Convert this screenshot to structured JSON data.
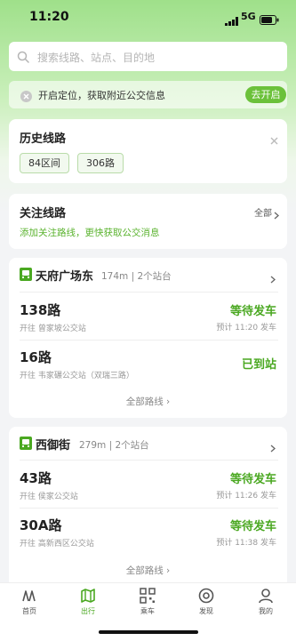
{
  "status_bar": {
    "time": "11:20",
    "network": "5G"
  },
  "search": {
    "placeholder": "搜索线路、站点、目的地"
  },
  "location_banner": {
    "text": "开启定位，获取附近公交信息",
    "button_label": "去开启"
  },
  "history": {
    "title": "历史线路",
    "items": [
      "84区间",
      "306路"
    ]
  },
  "follow": {
    "title": "关注线路",
    "all_label": "全部",
    "hint": "添加关注路线，更快获取公交消息"
  },
  "stops": [
    {
      "name": "天府广场东",
      "meta": "174m | 2个站台",
      "routes": [
        {
          "name": "138路",
          "origin": "开往 曾家坡公交站",
          "status": "等待发车",
          "eta": "预计 11:20 发车"
        },
        {
          "name": "16路",
          "origin": "开往 韦家碾公交站（双瑞三路）",
          "status": "已到站",
          "eta": ""
        }
      ],
      "all_routes_label": "全部路线"
    },
    {
      "name": "西御街",
      "meta": "279m | 2个站台",
      "routes": [
        {
          "name": "43路",
          "origin": "开往 侯家公交站",
          "status": "等待发车",
          "eta": "预计 11:26 发车"
        },
        {
          "name": "30A路",
          "origin": "开往 高新西区公交站",
          "status": "等待发车",
          "eta": "预计 11:38 发车"
        }
      ],
      "all_routes_label": "全部路线"
    }
  ],
  "tab_bar": {
    "items": [
      {
        "label": "首页",
        "icon": "home-icon"
      },
      {
        "label": "出行",
        "icon": "map-icon"
      },
      {
        "label": "乘车",
        "icon": "qr-code-icon"
      },
      {
        "label": "发现",
        "icon": "discover-icon"
      },
      {
        "label": "我的",
        "icon": "profile-icon"
      }
    ],
    "active_index": 1
  },
  "colors": {
    "accent": "#4aa821",
    "button": "#6bc13a",
    "header_gradient": "#9fe08a"
  }
}
